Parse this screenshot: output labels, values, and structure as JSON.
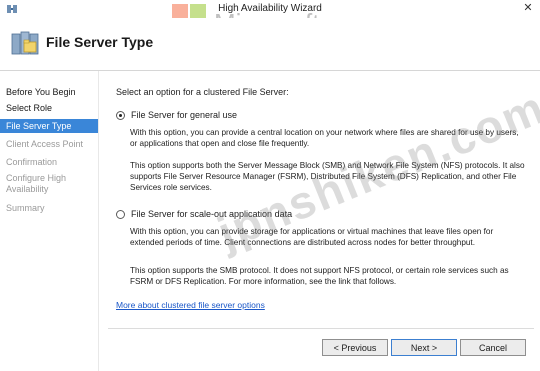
{
  "window": {
    "title": "High Availability Wizard",
    "close_glyph": "✕"
  },
  "watermark": {
    "brand": "Microsoft",
    "overlay": "jpnshiken.com"
  },
  "header": {
    "title": "File Server Type",
    "icon": "file-server-icon"
  },
  "nav": {
    "items": [
      {
        "label": "Before You Begin",
        "state": "normal"
      },
      {
        "label": "Select Role",
        "state": "normal"
      },
      {
        "label": "File Server Type",
        "state": "active"
      },
      {
        "label": "Client Access Point",
        "state": "disabled"
      },
      {
        "label": "Confirmation",
        "state": "disabled"
      },
      {
        "label": "Configure High Availability",
        "state": "disabled"
      },
      {
        "label": "Summary",
        "state": "disabled"
      }
    ]
  },
  "content": {
    "intro": "Select an option for a clustered File Server:",
    "options": [
      {
        "label": "File Server for general use",
        "selected": true,
        "desc1": "With this option, you can provide a central location on your network where files are shared for use by users, or applications that open and close file frequently.",
        "desc2": "This option supports both the Server Message Block (SMB) and Network File System (NFS) protocols. It also supports File Server Resource Manager (FSRM), Distributed File System (DFS) Replication, and other File Services role services."
      },
      {
        "label": "File Server for scale-out application data",
        "selected": false,
        "desc1": "With this option, you can provide storage for applications or virtual machines that leave files open for extended periods of time. Client connections are distributed across nodes for better throughput.",
        "desc2": "This option supports the SMB protocol. It does not support NFS protocol, or certain role services such as FSRM or DFS Replication. For more information, see the link that follows."
      }
    ],
    "link": "More about clustered file server options"
  },
  "buttons": {
    "previous": "< Previous",
    "next": "Next >",
    "cancel": "Cancel"
  },
  "colors": {
    "accent": "#3a86d8",
    "link": "#1a57c8"
  }
}
